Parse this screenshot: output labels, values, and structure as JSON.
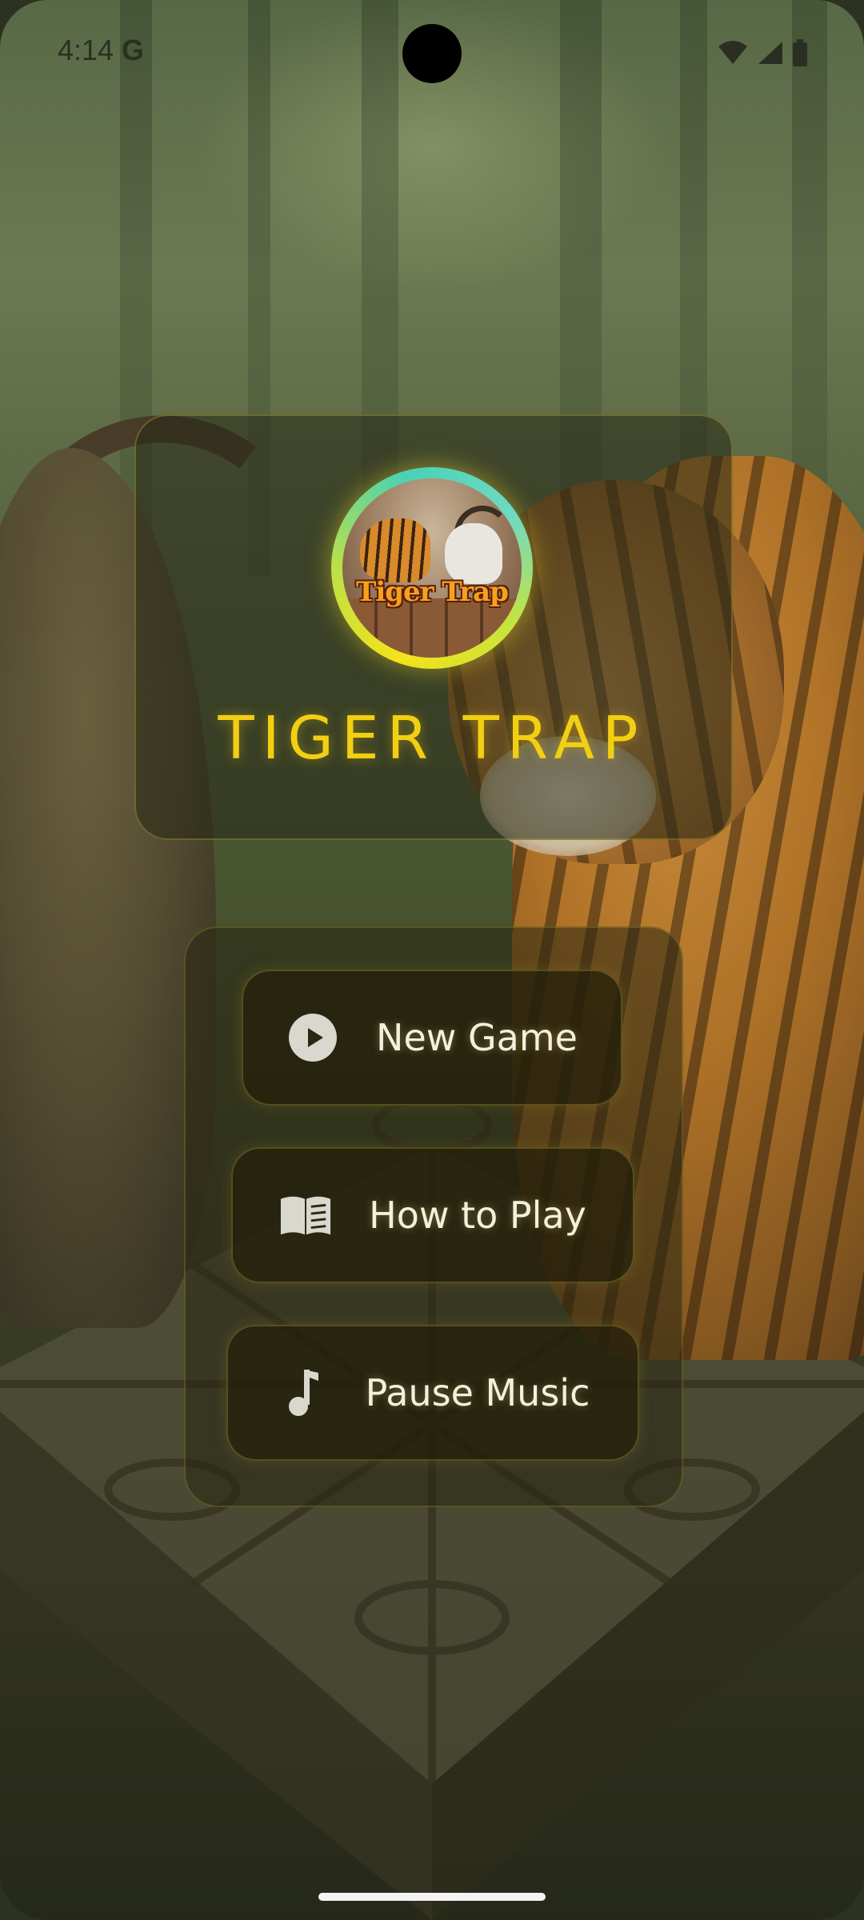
{
  "status_bar": {
    "time": "4:14",
    "g_logo": "G",
    "icons": [
      "wifi-icon",
      "signal-icon",
      "battery-icon"
    ]
  },
  "title_card": {
    "logo_text": "Tiger Trap",
    "title": "TIGER TRAP"
  },
  "menu": {
    "new_game": "New Game",
    "how_to_play": "How to Play",
    "pause_music": "Pause Music"
  },
  "colors": {
    "title": "#f2cf12",
    "button_text": "#f3f0dc",
    "card_border": "#c8b43c"
  }
}
